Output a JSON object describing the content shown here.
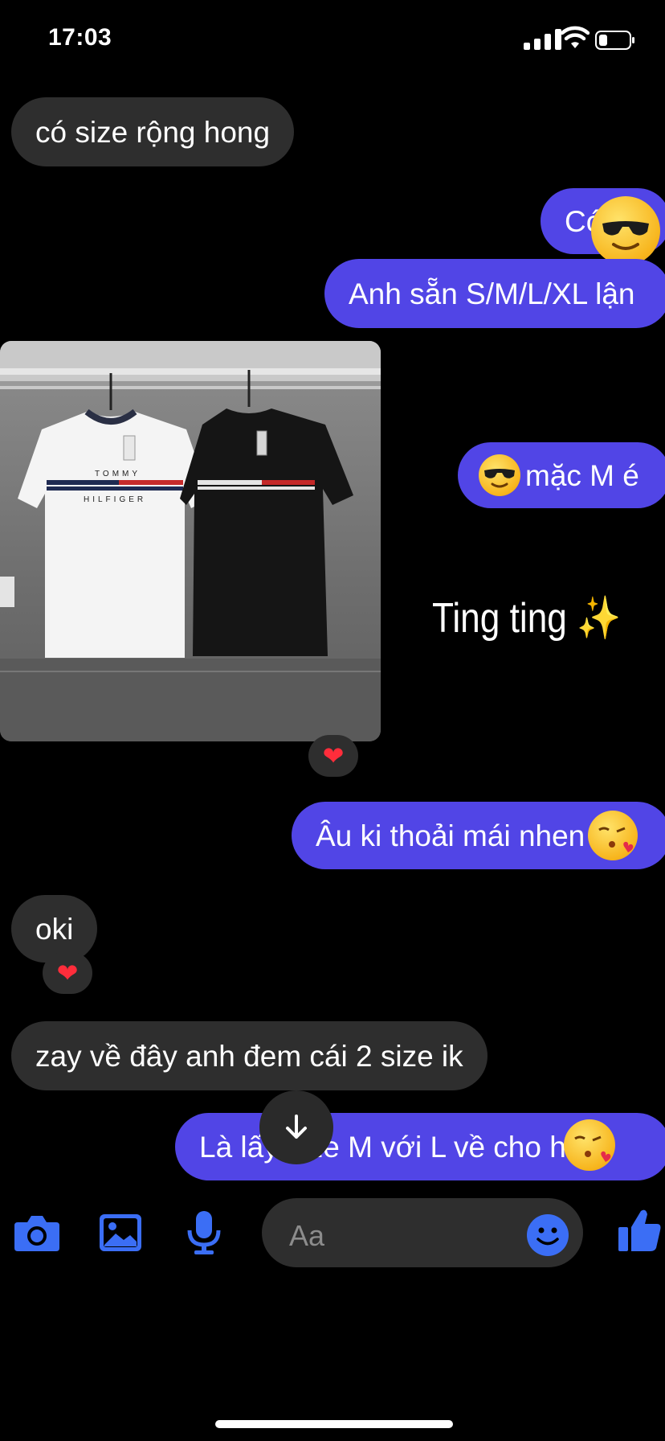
{
  "status_bar": {
    "time": "17:03"
  },
  "messages": {
    "m1": "có size rộng hong",
    "m2": "Có",
    "m3": "Anh sẵn S/M/L/XL lận",
    "m4": "mặc M é",
    "m5": "Âu ki thoải mái nhen",
    "m6": "oki",
    "m7": "zay về đây anh đem cái 2 size ik",
    "m8": "Là lấy size M với L về cho hẻ"
  },
  "photo": {
    "brand_top": "TOMMY",
    "brand_bottom": "HILFIGER"
  },
  "overlay_text": "Ting ting ✨",
  "reactions": {
    "heart": "❤"
  },
  "composer": {
    "placeholder": "Aa"
  },
  "icons": [
    "camera-icon",
    "image-icon",
    "microphone-icon",
    "emoji-icon",
    "thumbs-up-icon",
    "arrow-down-icon",
    "signal-icon",
    "wifi-icon",
    "battery-icon"
  ],
  "colors": {
    "outgoing": "#5145e6",
    "incoming": "#2e2e2e",
    "accent_icon": "#3b6ef5"
  }
}
